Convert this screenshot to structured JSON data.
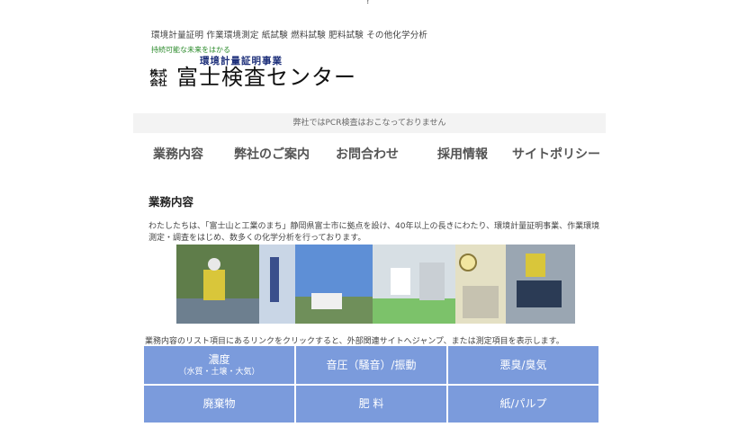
{
  "top_mark": "?",
  "header": {
    "tagline": "環境計量証明 作業環境測定 紙試験 燃料試験 肥料試験 その他化学分析"
  },
  "logo": {
    "motto": "持続可能な未来をはかる",
    "subtitle": "環境計量証明事業",
    "kaisha_top": "株式",
    "kaisha_bottom": "会社",
    "company_name": "富士検査センター"
  },
  "notice": "弊社ではPCR検査はおこなっておりません",
  "nav": {
    "items": [
      {
        "label": "業務内容"
      },
      {
        "label": "弊社のご案内"
      },
      {
        "label": "お問合わせ"
      },
      {
        "label": "採用情報"
      },
      {
        "label": "サイトポリシー"
      }
    ]
  },
  "main": {
    "section_title": "業務内容",
    "intro": "わたしたちは、「富士山と工業のまち」静岡県富士市に拠点を設け、40年以上の長きにわたり、環境計量証明事業、作業環境測定・調査をはじめ、数多くの化学分析を行っております。",
    "hint": "業務内容のリスト項目にあるリンクをクリックすると、外部関連サイトへジャンプ、または測定項目を表示します。",
    "services": [
      {
        "label": "濃度",
        "sub": "（水質・土壌・大気）"
      },
      {
        "label": "音圧（騒音）/振動",
        "sub": ""
      },
      {
        "label": "悪臭/臭気",
        "sub": ""
      },
      {
        "label": "廃棄物",
        "sub": ""
      },
      {
        "label": "肥 料",
        "sub": ""
      },
      {
        "label": "紙/パルプ",
        "sub": ""
      }
    ]
  },
  "colors": {
    "service_cell": "#7b9bdc",
    "notice_bg": "#f3f3f3",
    "motto_green": "#2a8a2a",
    "subtitle_navy": "#1d2f7a"
  }
}
